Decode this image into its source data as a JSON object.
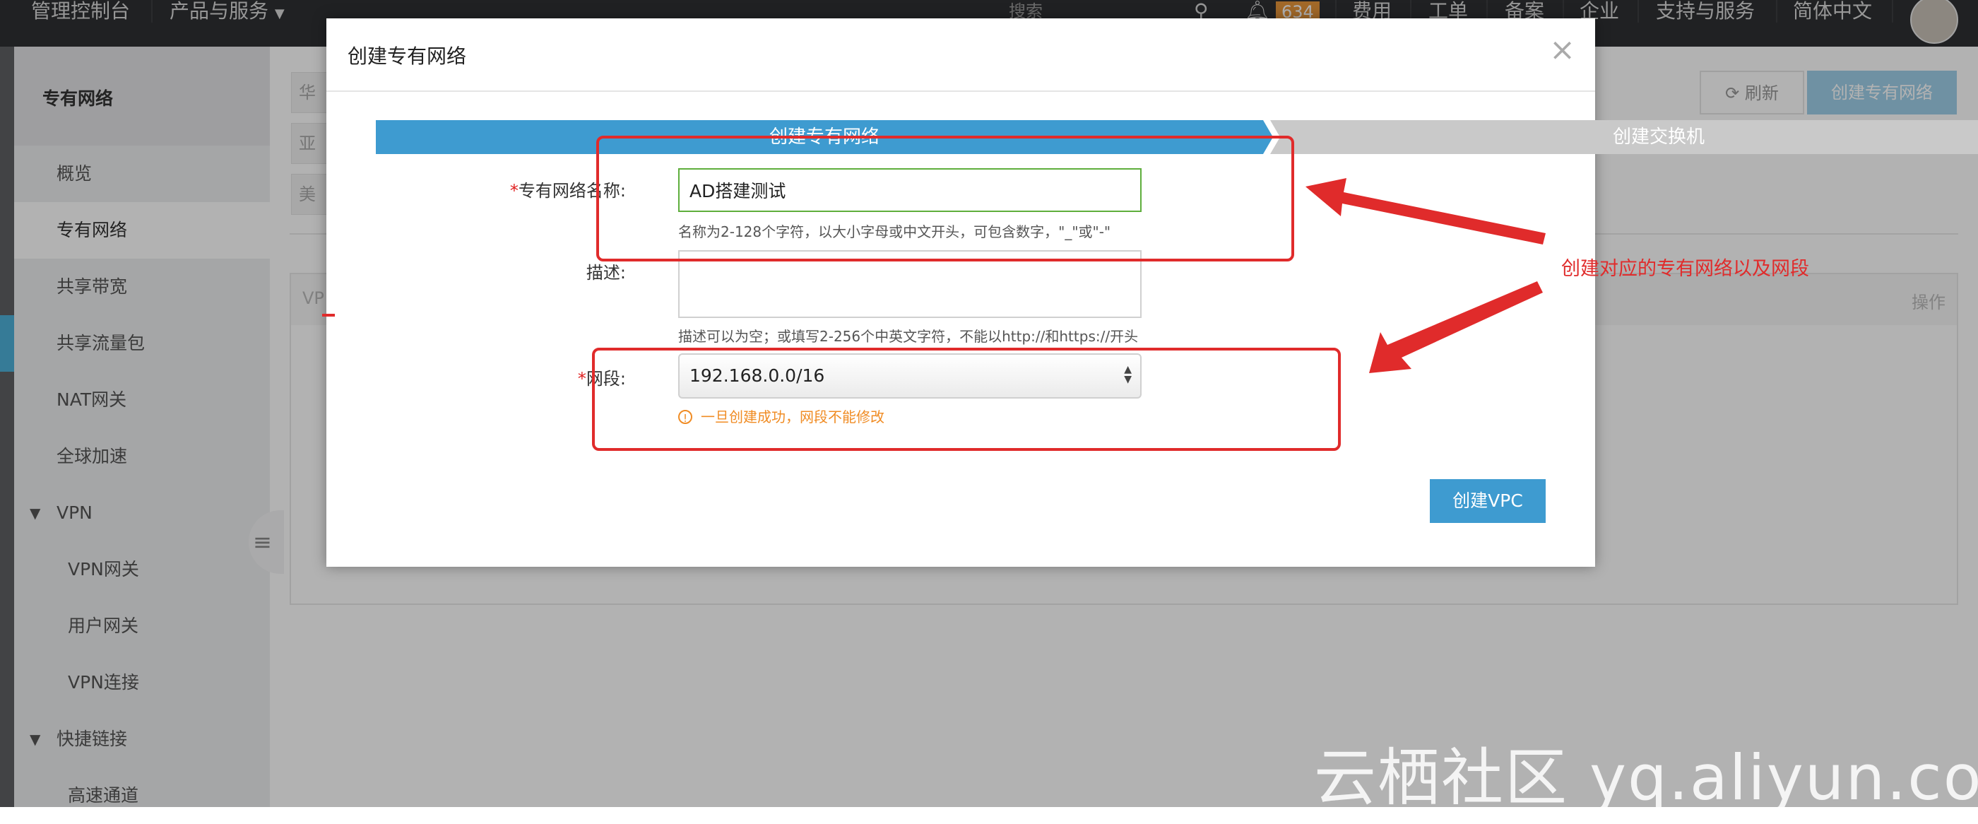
{
  "topbar": {
    "console": "管理控制台",
    "products": "产品与服务",
    "search_placeholder": "搜索",
    "notification_count": "634",
    "billing": "费用",
    "tickets": "工单",
    "icp": "备案",
    "enterprise": "企业",
    "support": "支持与服务",
    "language": "简体中文"
  },
  "sidebar": {
    "title": "专有网络",
    "items": [
      {
        "label": "概览"
      },
      {
        "label": "专有网络"
      },
      {
        "label": "共享带宽"
      },
      {
        "label": "共享流量包"
      },
      {
        "label": "NAT网关"
      },
      {
        "label": "全球加速"
      },
      {
        "label": "VPN"
      },
      {
        "label": "VPN网关"
      },
      {
        "label": "用户网关"
      },
      {
        "label": "VPN连接"
      },
      {
        "label": "快捷链接"
      },
      {
        "label": "高速通道"
      }
    ]
  },
  "main": {
    "region_tags": [
      "华",
      "亚",
      "美"
    ],
    "refresh_label": "刷新",
    "create_vpc_label": "创建专有网络",
    "table_col_vpc": "VP",
    "table_col_ops": "操作"
  },
  "modal": {
    "title": "创建专有网络",
    "close": "×",
    "steps": [
      "创建专有网络",
      "创建交换机"
    ],
    "name_label": "专有网络名称:",
    "name_value": "AD搭建测试",
    "name_hint": "名称为2-128个字符，以大小字母或中文开头，可包含数字，\"_\"或\"-\"",
    "desc_label": "描述:",
    "desc_value": "",
    "desc_hint": "描述可以为空；或填写2-256个中英文字符，不能以http://和https://开头",
    "cidr_label": "网段:",
    "cidr_value": "192.168.0.0/16",
    "cidr_warning": "一旦创建成功，网段不能修改",
    "required_mark": "*",
    "submit_label": "创建VPC"
  },
  "annotation": {
    "text": "创建对应的专有网络以及网段"
  },
  "watermark": "云栖社区 yq.aliyun.com",
  "colors": {
    "topbar": "#2f3033",
    "accent": "#3e9bd0",
    "annotation": "#e02b2b",
    "warning": "#f08c24"
  }
}
